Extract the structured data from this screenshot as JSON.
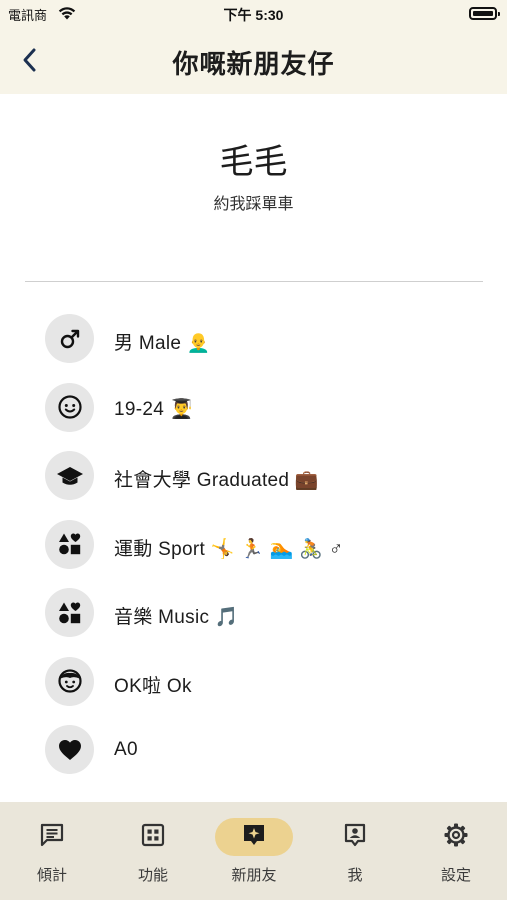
{
  "status_bar": {
    "carrier": "電訊商",
    "time": "下午 5:30"
  },
  "nav": {
    "title": "你嘅新朋友仔"
  },
  "profile": {
    "name": "毛毛",
    "bio": "約我踩單車"
  },
  "details": [
    {
      "icon": "male-symbol-icon",
      "text": "男 Male 👨‍🦲"
    },
    {
      "icon": "face-icon",
      "text": "19-24 👨‍🎓"
    },
    {
      "icon": "graduation-cap-icon",
      "text": "社會大學 Graduated 💼"
    },
    {
      "icon": "category-shapes-icon",
      "text": "運動 Sport 🤸 🏃 🏊 🚴 ♂"
    },
    {
      "icon": "category-shapes-icon",
      "text": "音樂 Music 🎵"
    },
    {
      "icon": "child-face-icon",
      "text": "OK啦 Ok"
    },
    {
      "icon": "heart-icon",
      "text": "A0"
    }
  ],
  "tabs": [
    {
      "label": "傾計",
      "icon": "chat-icon",
      "active": false
    },
    {
      "label": "功能",
      "icon": "grid-icon",
      "active": false
    },
    {
      "label": "新朋友",
      "icon": "sparkle-card-icon",
      "active": true
    },
    {
      "label": "我",
      "icon": "profile-card-icon",
      "active": false
    },
    {
      "label": "設定",
      "icon": "gear-icon",
      "active": false
    }
  ],
  "colors": {
    "header_bg": "#f7f4e8",
    "tab_bar_bg": "#eae6da",
    "active_tab_pill": "#ecd290",
    "icon_circle": "#e6e6e6"
  }
}
